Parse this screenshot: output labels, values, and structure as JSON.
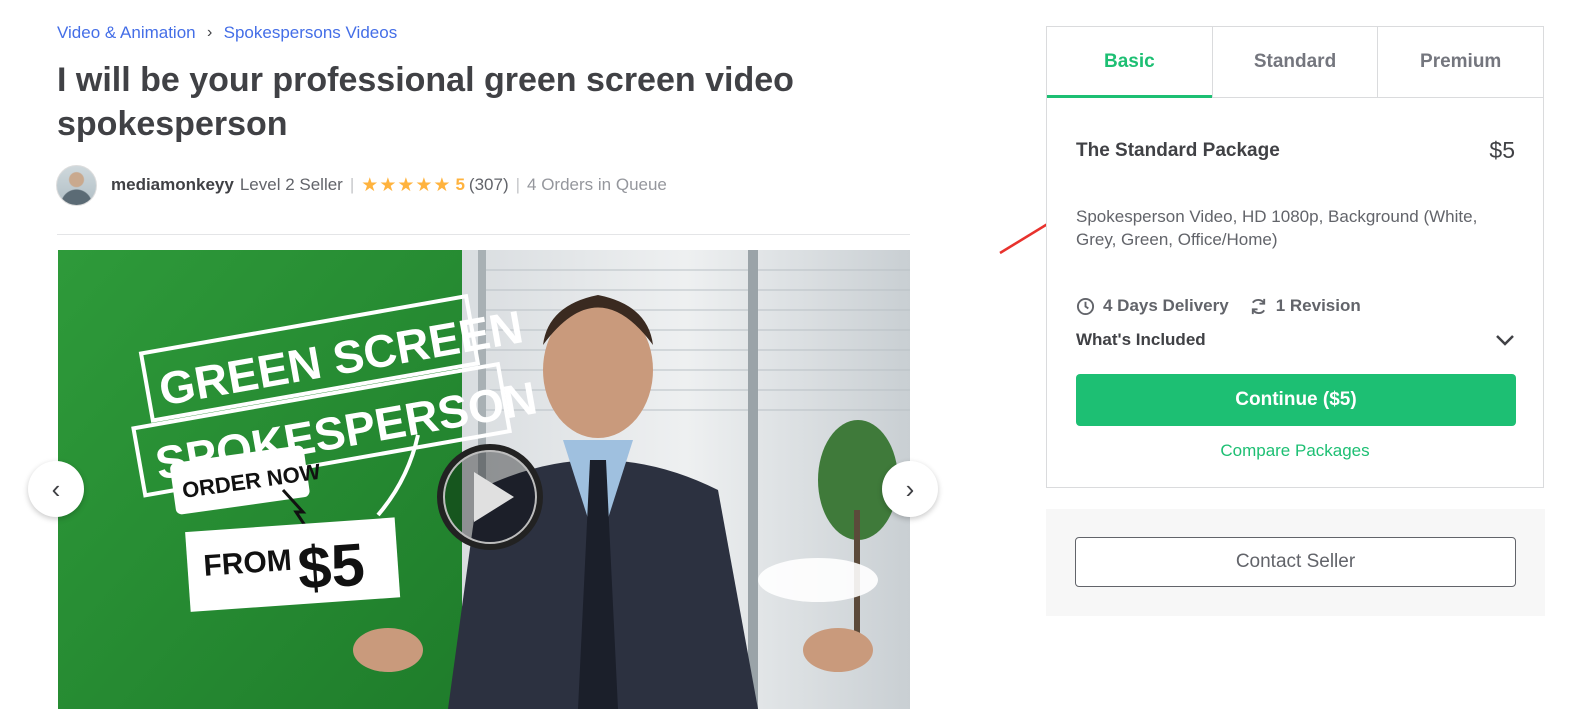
{
  "breadcrumb": {
    "items": [
      "Video & Animation",
      "Spokespersons Videos"
    ],
    "separator": "›"
  },
  "gig": {
    "title": "I will be your professional green screen video spokesperson"
  },
  "seller": {
    "name": "mediamonkeyy",
    "level": "Level 2 Seller",
    "stars": "★★★★★",
    "rating": "5",
    "rating_value": 5,
    "reviews": "(307)",
    "orders_in_queue": "4 Orders in Queue"
  },
  "gallery": {
    "thumbnail_text": {
      "line1": "GREEN SCREEN",
      "line2": "SPOKESPERSON",
      "cta": "ORDER NOW",
      "from": "FROM",
      "price": "$5"
    },
    "prev_icon": "chevron-left-icon",
    "next_icon": "chevron-right-icon",
    "play_icon": "play-icon"
  },
  "packages": {
    "tabs": [
      "Basic",
      "Standard",
      "Premium"
    ],
    "active_tab": "Basic",
    "name": "The Standard Package",
    "price": "$5",
    "description": "Spokesperson Video, HD 1080p, Background (White, Grey, Green, Office/Home)",
    "delivery": "4 Days Delivery",
    "revisions": "1 Revision",
    "whats_included": "What's Included",
    "continue_label": "Continue ($5)",
    "compare_label": "Compare Packages"
  },
  "contact": {
    "label": "Contact Seller"
  },
  "colors": {
    "accent_green": "#1dbf73",
    "link_blue": "#446ee7",
    "star": "#ffb33e",
    "annotation_arrow": "#e8322d"
  }
}
